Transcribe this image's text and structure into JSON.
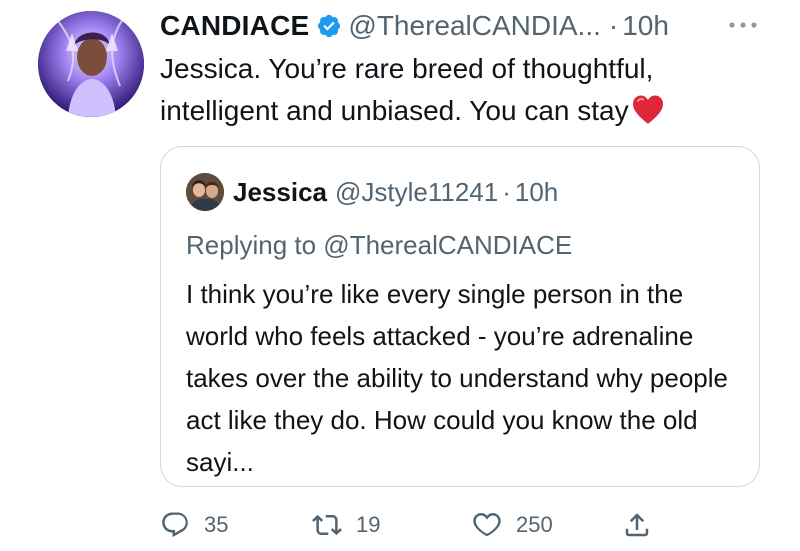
{
  "tweet": {
    "display_name": "CANDIACE",
    "handle": "@TherealCANDIA...",
    "separator": "·",
    "time": "10h",
    "text": "Jessica. You’re rare breed of thoughtful, intelligent and unbiased. You can stay",
    "emoji": "heart-emoji",
    "verified": true
  },
  "quoted": {
    "display_name": "Jessica",
    "handle": "@Jstyle11241",
    "separator": "·",
    "time": "10h",
    "replying_to": "Replying to @TherealCANDIACE",
    "text": "I think you’re like every single person in the world who feels attacked - you’re adrenaline takes over the ability to understand why people act like they do. How could you know  the old sayi..."
  },
  "actions": {
    "replies": "35",
    "retweets": "19",
    "likes": "250"
  },
  "colors": {
    "text": "#0f1419",
    "secondary": "#536471",
    "verified_blue": "#1d9bf0",
    "border": "#cfd9de",
    "heart_red": "#e0263a"
  },
  "icons": [
    "verified-badge-icon",
    "more-icon",
    "heart-emoji",
    "reply-icon",
    "retweet-icon",
    "like-icon",
    "share-icon"
  ]
}
